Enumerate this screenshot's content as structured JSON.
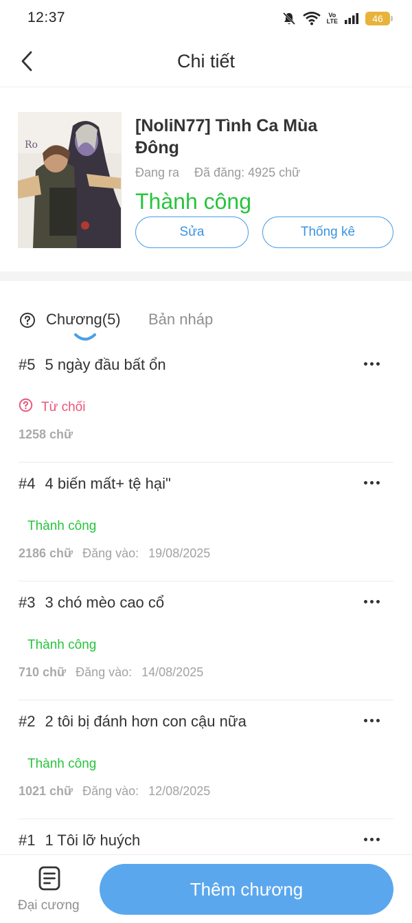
{
  "status_bar": {
    "time": "12:37",
    "volte_top": "Vo",
    "volte_bottom": "LTE",
    "battery": "46"
  },
  "header": {
    "title": "Chi tiết"
  },
  "book": {
    "title": "[NoliN77] Tình Ca Mùa Đông",
    "state": "Đang ra",
    "published_words": "Đã đăng: 4925 chữ",
    "status": "Thành công",
    "status_color": "#27c43c",
    "edit_label": "Sửa",
    "stats_label": "Thống kê"
  },
  "tabs": {
    "chapters_label": "Chương(5)",
    "drafts_label": "Bản nháp"
  },
  "chapters": [
    {
      "num": "#5",
      "title": "5 ngày đầu bất ổn",
      "status": "Từ chối",
      "words": "1258 chữ",
      "date_label": "",
      "date": ""
    },
    {
      "num": "#4",
      "title": "4 biến mất+ tệ hại\"",
      "status": "Thành công",
      "words": "2186 chữ",
      "date_label": "Đăng vào:",
      "date": "19/08/2025"
    },
    {
      "num": "#3",
      "title": "3 chó mèo cao cổ",
      "status": "Thành công",
      "words": "710 chữ",
      "date_label": "Đăng vào:",
      "date": "14/08/2025"
    },
    {
      "num": "#2",
      "title": "2 tôi bị đánh hơn con cậu nữa",
      "status": "Thành công",
      "words": "1021 chữ",
      "date_label": "Đăng vào:",
      "date": "12/08/2025"
    },
    {
      "num": "#1",
      "title": "1 Tôi lỡ huých",
      "status": "",
      "words": "",
      "date_label": "",
      "date": ""
    }
  ],
  "bottom": {
    "outline_label": "Đại cương",
    "add_chapter_label": "Thêm chương"
  },
  "colors": {
    "accent": "#5aa7ee",
    "success": "#27c43c",
    "rejected": "#e8567a"
  }
}
